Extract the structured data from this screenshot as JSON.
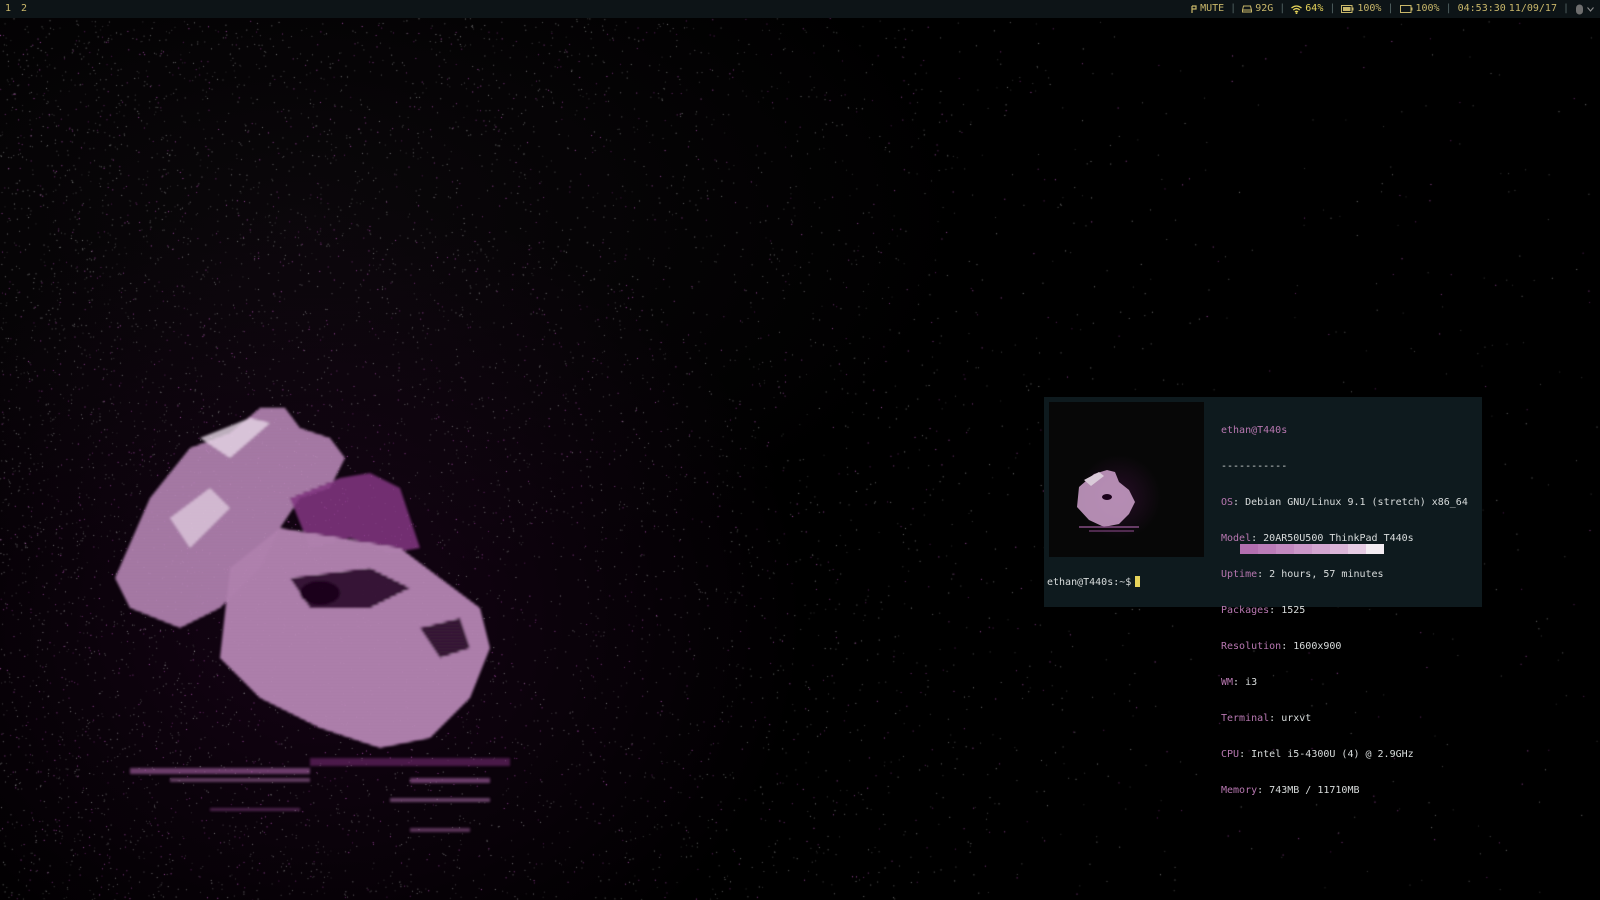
{
  "bar": {
    "workspaces": [
      "1",
      "2"
    ],
    "status": {
      "volume": "MUTE",
      "disk": "92G",
      "wifi": "64%",
      "battery1": "100%",
      "battery2": "100%",
      "time": "04:53:30",
      "date": "11/09/17"
    },
    "icons": {
      "volume": "speaker-icon",
      "disk": "disk-icon",
      "wifi": "wifi-icon",
      "battery1": "battery-icon",
      "battery2": "battery-outline-icon",
      "tray": "tray-icon",
      "tray_arrow": "chevron-down-icon"
    }
  },
  "terminal": {
    "user_host": "ethan@T440s",
    "separator": "-----------",
    "info": [
      {
        "key": "OS",
        "value": "Debian GNU/Linux 9.1 (stretch) x86_64"
      },
      {
        "key": "Model",
        "value": "20AR50U500 ThinkPad T440s"
      },
      {
        "key": "Uptime",
        "value": "2 hours, 57 minutes"
      },
      {
        "key": "Packages",
        "value": "1525"
      },
      {
        "key": "Resolution",
        "value": "1600x900"
      },
      {
        "key": "WM",
        "value": "i3"
      },
      {
        "key": "Terminal",
        "value": "urxvt"
      },
      {
        "key": "CPU",
        "value": "Intel i5-4300U (4) @ 2.9GHz"
      },
      {
        "key": "Memory",
        "value": "743MB / 11710MB"
      }
    ],
    "swatch_colors": [
      "#b36fb0",
      "#bb7cb8",
      "#c389c0",
      "#cb97c8",
      "#d3a5d0",
      "#dbb5d8",
      "#e6cbe3",
      "#f3ecf2"
    ],
    "prompt": "ethan@T440s:~$"
  },
  "colors": {
    "bar_bg": "#0d1417",
    "bar_fg": "#c9b76a",
    "accent_pink": "#b777b0",
    "cursor": "#e6d35a",
    "terminal_bg": "#0e1a1e"
  }
}
